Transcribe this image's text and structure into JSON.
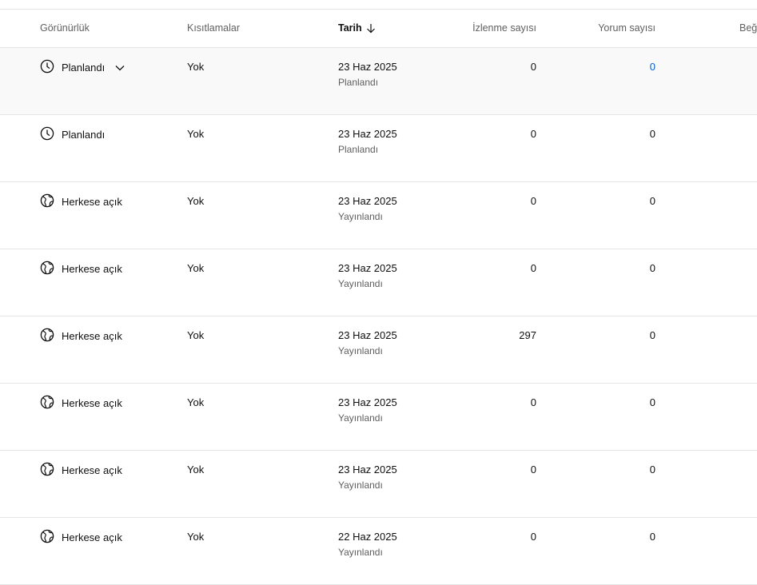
{
  "headers": {
    "visibility": "Görünürlük",
    "restrictions": "Kısıtlamalar",
    "date": "Tarih",
    "views": "İzlenme sayısı",
    "comments": "Yorum sayısı",
    "likes": "Beğ"
  },
  "rows": [
    {
      "visibility": "Planlandı",
      "visibility_icon": "clock-icon",
      "has_dropdown": true,
      "restrictions": "Yok",
      "date": "23 Haz 2025",
      "date_status": "Planlandı",
      "views": "0",
      "comments": "0",
      "comments_link": true,
      "highlighted": true
    },
    {
      "visibility": "Planlandı",
      "visibility_icon": "clock-icon",
      "has_dropdown": false,
      "restrictions": "Yok",
      "date": "23 Haz 2025",
      "date_status": "Planlandı",
      "views": "0",
      "comments": "0"
    },
    {
      "visibility": "Herkese açık",
      "visibility_icon": "globe-icon",
      "has_dropdown": false,
      "restrictions": "Yok",
      "date": "23 Haz 2025",
      "date_status": "Yayınlandı",
      "views": "0",
      "comments": "0"
    },
    {
      "visibility": "Herkese açık",
      "visibility_icon": "globe-icon",
      "has_dropdown": false,
      "restrictions": "Yok",
      "date": "23 Haz 2025",
      "date_status": "Yayınlandı",
      "views": "0",
      "comments": "0"
    },
    {
      "visibility": "Herkese açık",
      "visibility_icon": "globe-icon",
      "has_dropdown": false,
      "restrictions": "Yok",
      "date": "23 Haz 2025",
      "date_status": "Yayınlandı",
      "views": "297",
      "comments": "0"
    },
    {
      "visibility": "Herkese açık",
      "visibility_icon": "globe-icon",
      "has_dropdown": false,
      "restrictions": "Yok",
      "date": "23 Haz 2025",
      "date_status": "Yayınlandı",
      "views": "0",
      "comments": "0"
    },
    {
      "visibility": "Herkese açık",
      "visibility_icon": "globe-icon",
      "has_dropdown": false,
      "restrictions": "Yok",
      "date": "23 Haz 2025",
      "date_status": "Yayınlandı",
      "views": "0",
      "comments": "0"
    },
    {
      "visibility": "Herkese açık",
      "visibility_icon": "globe-icon",
      "has_dropdown": false,
      "restrictions": "Yok",
      "date": "22 Haz 2025",
      "date_status": "Yayınlandı",
      "views": "0",
      "comments": "0"
    }
  ],
  "colors": {
    "link": "#065fd4",
    "secondary_text": "#606060",
    "divider": "#e5e5e5",
    "row_highlight": "#f9f9f9"
  }
}
